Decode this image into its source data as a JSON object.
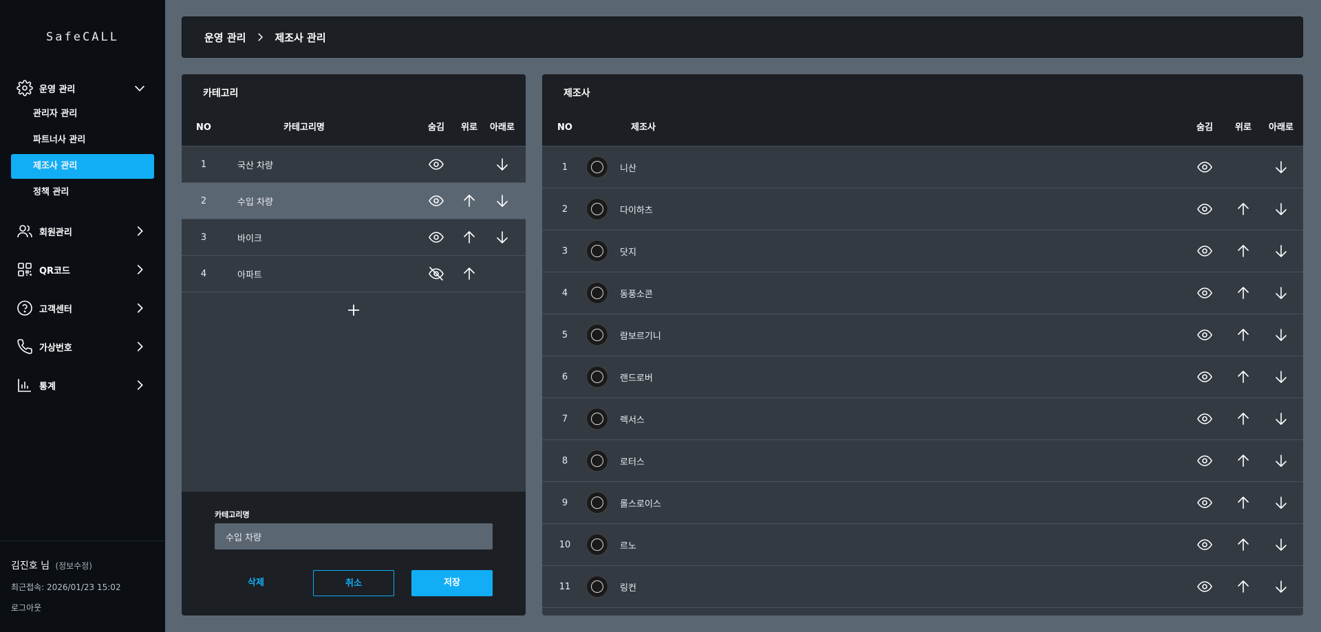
{
  "app": {
    "logo": "SafeCALL"
  },
  "sidebar": {
    "groups": [
      {
        "label": "운영 관리",
        "icon": "gear-icon",
        "expanded": true
      },
      {
        "label": "회원관리",
        "icon": "users-icon",
        "expanded": false
      },
      {
        "label": "QR코드",
        "icon": "qr-code-icon",
        "expanded": false
      },
      {
        "label": "고객센터",
        "icon": "help-circle-icon",
        "expanded": false
      },
      {
        "label": "가상번호",
        "icon": "phone-icon",
        "expanded": false
      },
      {
        "label": "통계",
        "icon": "bar-chart-icon",
        "expanded": false
      }
    ],
    "sub_items": [
      {
        "label": "관리자 관리",
        "active": false
      },
      {
        "label": "파트너사 관리",
        "active": false
      },
      {
        "label": "제조사 관리",
        "active": true
      },
      {
        "label": "정책 관리",
        "active": false
      }
    ],
    "user": {
      "name": "김진호 님",
      "edit_label": "(정보수정)",
      "last_access": "최근접속: 2026/01/23 15:02",
      "logout": "로그아웃"
    }
  },
  "breadcrumb": {
    "parent": "운영 관리",
    "current": "제조사 관리"
  },
  "category_panel": {
    "title": "카테고리",
    "columns": {
      "no": "NO",
      "name": "카테고리명",
      "hide": "숨김",
      "up": "위로",
      "down": "아래로"
    },
    "rows": [
      {
        "no": "1",
        "name": "국산 차량",
        "hidden": false,
        "can_up": false,
        "can_down": true,
        "selected": false
      },
      {
        "no": "2",
        "name": "수입 차량",
        "hidden": false,
        "can_up": true,
        "can_down": true,
        "selected": true
      },
      {
        "no": "3",
        "name": "바이크",
        "hidden": false,
        "can_up": true,
        "can_down": true,
        "selected": false
      },
      {
        "no": "4",
        "name": "아파트",
        "hidden": true,
        "can_up": true,
        "can_down": false,
        "selected": false
      }
    ],
    "form": {
      "label": "카테고리명",
      "value": "수입 차량",
      "delete": "삭제",
      "cancel": "취소",
      "save": "저장"
    }
  },
  "maker_panel": {
    "title": "제조사",
    "columns": {
      "no": "NO",
      "name": "제조사",
      "hide": "숨김",
      "up": "위로",
      "down": "아래로"
    },
    "rows": [
      {
        "no": "1",
        "name": "니산",
        "can_up": false,
        "can_down": true
      },
      {
        "no": "2",
        "name": "다이하츠",
        "can_up": true,
        "can_down": true
      },
      {
        "no": "3",
        "name": "닷지",
        "can_up": true,
        "can_down": true
      },
      {
        "no": "4",
        "name": "동풍소콘",
        "can_up": true,
        "can_down": true
      },
      {
        "no": "5",
        "name": "람보르기니",
        "can_up": true,
        "can_down": true
      },
      {
        "no": "6",
        "name": "랜드로버",
        "can_up": true,
        "can_down": true
      },
      {
        "no": "7",
        "name": "렉서스",
        "can_up": true,
        "can_down": true
      },
      {
        "no": "8",
        "name": "로터스",
        "can_up": true,
        "can_down": true
      },
      {
        "no": "9",
        "name": "롤스로이스",
        "can_up": true,
        "can_down": true
      },
      {
        "no": "10",
        "name": "르노",
        "can_up": true,
        "can_down": true
      },
      {
        "no": "11",
        "name": "링컨",
        "can_up": true,
        "can_down": true
      }
    ]
  },
  "colors": {
    "accent": "#12aef5",
    "sidebar_bg": "#0b0f14",
    "panel_header": "#1c1f24",
    "panel_body": "#333a42",
    "page_bg": "#5b6673"
  }
}
